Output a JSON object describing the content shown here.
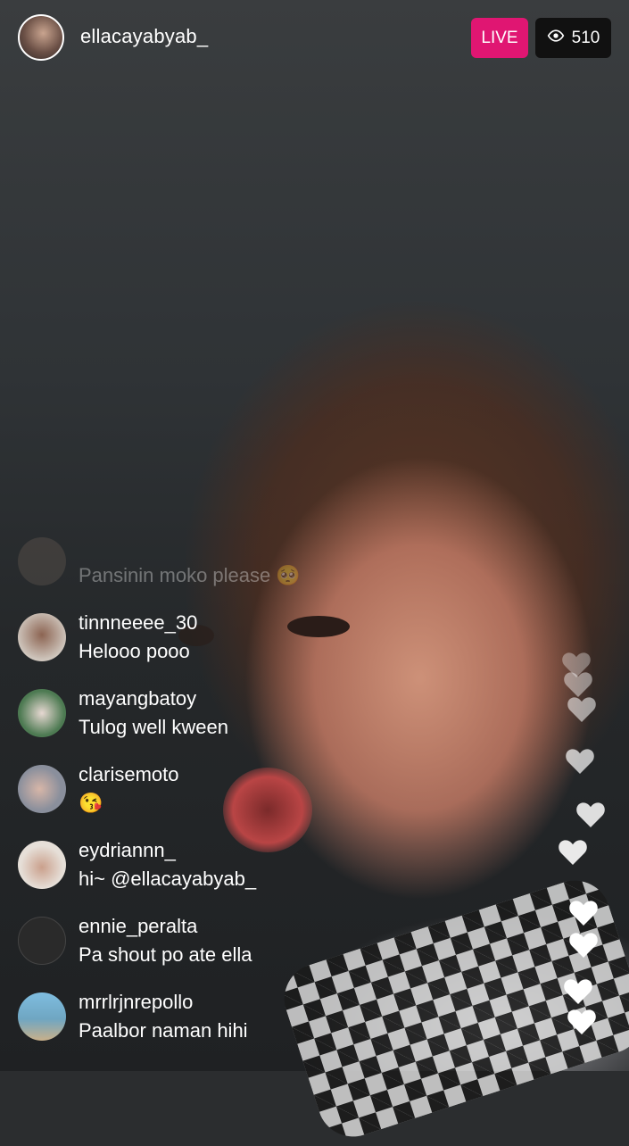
{
  "host": {
    "username": "ellacayabyab_",
    "live_label": "LIVE",
    "viewer_count": "510",
    "viewer_icon": "eye-icon"
  },
  "comments": [
    {
      "user": "",
      "message": "Pansinin moko please 🥺",
      "avatar_color": "#6b5f55"
    },
    {
      "user": "tinnneeee_30",
      "message": "Helooo pooo",
      "avatar_color": "#cfc6bd"
    },
    {
      "user": "mayangbatoy",
      "message": "Tulog well kween",
      "avatar_color": "#4d7a52"
    },
    {
      "user": "clarisemoto",
      "message": "😘",
      "avatar_color": "#8a8f9c"
    },
    {
      "user": "eydriannn_",
      "message": "hi~ @ellacayabyab_",
      "avatar_color": "#e6dfd8"
    },
    {
      "user": "ennie_peralta",
      "message": "Pa shout po ate ella",
      "avatar_color": "#2a2a2a"
    },
    {
      "user": "mrrlrjnrepollo",
      "message": "Paalbor naman hihi",
      "avatar_color": "#6fa6c2"
    }
  ],
  "hearts_icon": "heart-icon"
}
